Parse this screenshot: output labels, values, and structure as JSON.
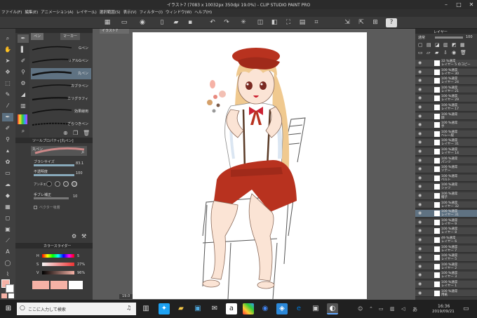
{
  "window": {
    "title": "イラスト7 (7083 x 10032px 350dpi 19.0%) - CLIP STUDIO PAINT PRO"
  },
  "menu": [
    "ファイル(F)",
    "編集(E)",
    "アニメーション(A)",
    "レイヤー(L)",
    "選択範囲(S)",
    "表示(V)",
    "フィルター(I)",
    "ウィンドウ(W)",
    "ヘルプ(H)"
  ],
  "subtool": {
    "tab_pen": "ペン",
    "tab_marker": "マーカー",
    "brushes": [
      "Gペン",
      "リアルGペン",
      "丸ペン",
      "カブラペン",
      "カリグラフィ",
      "効果線用",
      "ざらつきペン"
    ],
    "selected": "丸ペン"
  },
  "tool_property": {
    "panel_title": "ツールプロパティ[丸ペン]",
    "brush_name": "丸ペン",
    "brush_size_label": "ブラシサイズ",
    "brush_size_value": "83.1",
    "opacity_label": "不透明度",
    "opacity_value": "100",
    "antialias_label": "アンチエ",
    "stabilize_label": "手ブレ補正",
    "stabilize_value": "10",
    "vector_label": "ベクター吸着"
  },
  "color_panel": {
    "title": "カラースライダー",
    "h_label": "H",
    "s_label": "S",
    "v_label": "V",
    "h_value": "5",
    "s_value": "27%",
    "v_value": "96%",
    "main_color": "#f6b2a6"
  },
  "canvas_tab": "イラスト7",
  "zoom": "19.0",
  "layer_panel": {
    "tab": "レイヤー",
    "blend_mode": "通常",
    "opacity": "100",
    "layers": [
      {
        "pct": "32 %通常",
        "name": "レイヤー 5 のコピー"
      },
      {
        "pct": "100 %通常",
        "name": "レイヤー 30"
      },
      {
        "pct": "100 %通常",
        "name": "レイヤー 24"
      },
      {
        "pct": "100 %通常",
        "name": "レイヤー 21"
      },
      {
        "pct": "100 %通常",
        "name": "レイヤー 29"
      },
      {
        "pct": "100 %通常",
        "name": "レイヤー 17"
      },
      {
        "pct": "100 %通常",
        "name": "顔"
      },
      {
        "pct": "100 %通常",
        "name": "手"
      },
      {
        "pct": "100 %通常",
        "name": "ヘレ一般"
      },
      {
        "pct": "100 %通常",
        "name": "レイヤー 31"
      },
      {
        "pct": "100 %通常",
        "name": "レイヤー 14"
      },
      {
        "pct": "100 %通常",
        "name": "パンツ"
      },
      {
        "pct": "100 %通常",
        "name": "ソテー"
      },
      {
        "pct": "100 %通常",
        "name": "ベルト"
      },
      {
        "pct": "100 %通常",
        "name": "シャツ"
      },
      {
        "pct": "100 %通常",
        "name": "帽子"
      },
      {
        "pct": "100 %通常",
        "name": "レイヤー 32"
      },
      {
        "pct": "100 %通常",
        "name": "レイヤー 31"
      },
      {
        "pct": "100 %通常",
        "name": "レイヤー 9"
      },
      {
        "pct": "100 %通常",
        "name": "レイヤー 8"
      },
      {
        "pct": "49 %通常",
        "name": "レイヤー 6"
      },
      {
        "pct": "100 %通常",
        "name": "レイヤー 7"
      },
      {
        "pct": "100 %通常",
        "name": "レイヤー 5"
      },
      {
        "pct": "100 %通常",
        "name": "レイヤー 2"
      },
      {
        "pct": "100 %通常",
        "name": "レイヤー 3"
      },
      {
        "pct": "100 %通常",
        "name": "レイヤー 1"
      },
      {
        "pct": "100 %通常",
        "name": "用紙"
      }
    ]
  },
  "taskbar": {
    "search_placeholder": "ここに入力して検索",
    "time": "16:36",
    "date": "2019/09/21"
  },
  "colors": {
    "skin": "#fbe4d5",
    "hair": "#f0c98f",
    "red": "#b8321f",
    "shirt_shadow": "#dbe6f2"
  }
}
